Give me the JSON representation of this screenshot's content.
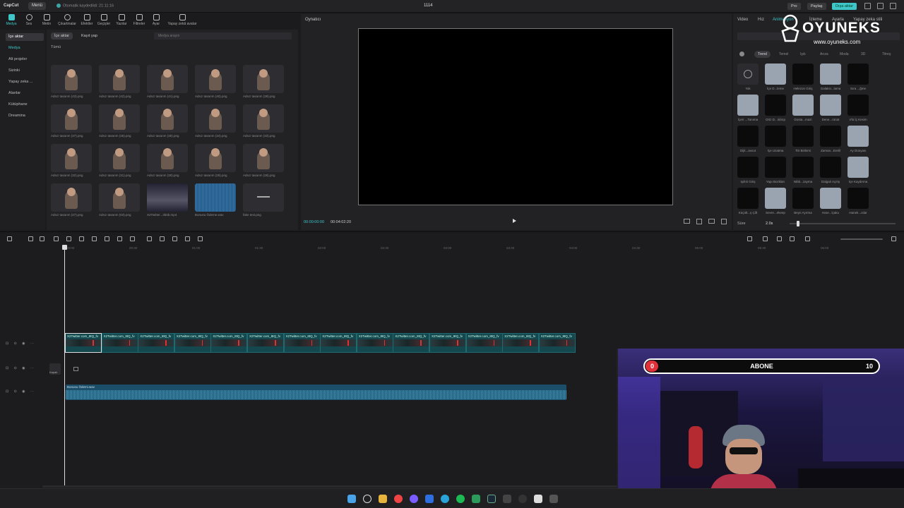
{
  "titlebar": {
    "app_name": "CapCut",
    "menu_label": "Menü",
    "autosave_text": "Otomatik kaydedildi: 21:11:16",
    "project_title": "1114",
    "pro_label": "Pro",
    "share_label": "Paylaş",
    "export_label": "Dışa aktar"
  },
  "top_tools": [
    {
      "label": "Medya",
      "icon": "media-icon"
    },
    {
      "label": "Ses",
      "icon": "audio-icon"
    },
    {
      "label": "Metin",
      "icon": "text-icon"
    },
    {
      "label": "Çıkartmalar",
      "icon": "sticker-icon"
    },
    {
      "label": "Efektler",
      "icon": "effects-icon"
    },
    {
      "label": "Geçişler",
      "icon": "transition-icon"
    },
    {
      "label": "Yazılar",
      "icon": "captions-icon"
    },
    {
      "label": "Filtreler",
      "icon": "filter-icon"
    },
    {
      "label": "Ayar",
      "icon": "adjust-icon"
    },
    {
      "label": "Yapay zekâ avatar",
      "icon": "avatar-icon"
    }
  ],
  "left_nav": [
    {
      "label": "İçe aktar"
    },
    {
      "label": "Medya"
    },
    {
      "label": "Alt projeler"
    },
    {
      "label": "Sizinki"
    },
    {
      "label": "Yapay zeka ..."
    },
    {
      "label": "Alanlar"
    },
    {
      "label": "Kütüphane"
    },
    {
      "label": "Dreamina"
    }
  ],
  "media_panel": {
    "import_tab": "İçe aktar",
    "record_tab": "Kayıt yap",
    "search_placeholder": "Medya arayın",
    "section_label": "Tümü",
    "thumbnails": [
      {
        "label": "Adsız tasarım (43).png"
      },
      {
        "label": "Adsız tasarım (42).png"
      },
      {
        "label": "Adsız tasarım (41).png"
      },
      {
        "label": "Adsız tasarım (40).png"
      },
      {
        "label": "Adsız tasarım (39).png"
      },
      {
        "label": "Adsız tasarım (37).png"
      },
      {
        "label": "Adsız tasarım (36).png"
      },
      {
        "label": "Adsız tasarım (35).png"
      },
      {
        "label": "Adsız tasarım (34).png"
      },
      {
        "label": "Adsız tasarım (33).png"
      },
      {
        "label": "Adsız tasarım (32).png"
      },
      {
        "label": "Adsız tasarım (31).png"
      },
      {
        "label": "Adsız tasarım (30).png"
      },
      {
        "label": "Adsız tasarım (29).png"
      },
      {
        "label": "Adsız tasarım (28).png"
      },
      {
        "label": "Adsız tasarım (27).png"
      },
      {
        "label": "Adsız tasarım (03).png"
      },
      {
        "label": "X2Twitter...3b0b.mp4"
      },
      {
        "label": "Bonusu Ödeme.wav"
      },
      {
        "label": "fake text.png"
      }
    ]
  },
  "player": {
    "title": "Oynatıcı",
    "current_time": "00:00:00:00",
    "total_time": "00:04:02:20"
  },
  "properties": {
    "tabs": [
      "Video",
      "Hız",
      "Animasyon",
      "İzleme",
      "Ayarla",
      "Yapay zeka stili"
    ],
    "categories": [
      "Trend",
      "Temel",
      "Işık",
      "Arıza",
      "Moda",
      "3D",
      "Titreş"
    ],
    "animations": [
      "Yok",
      "İçe D...leme",
      "Helezon Giriş",
      "Galaksi...lama",
      "Sıra ...ğme",
      "İçeri ...Tanıma",
      "Ortz D...ıldırıp",
      "Dosta...mazi",
      "Dene...rünüt",
      "4'lü İç Kesim",
      "Dijit...avcut",
      "İçe Uzatma",
      "Titr Birikimi",
      "Zaman...Erelil",
      "Ay Dünyası",
      "Işıltılı Giriş",
      "Yapı Bozkları",
      "Nibb...zayma",
      "Dalgalı Açılış",
      "İçe Kaydırma",
      "Küçült...ş Çift",
      "Sevre...ekeep",
      "Beyn Ayırma",
      "Hare...lçaku",
      "Hanek...ıslar"
    ],
    "duration_label": "Süre",
    "duration_value": "2.0s"
  },
  "timeline": {
    "ruler": [
      "00:00",
      "00:30",
      "01:00",
      "01:30",
      "02:00",
      "02:30",
      "03:00",
      "03:30",
      "04:00",
      "04:30",
      "05:00",
      "05:30",
      "06:00"
    ],
    "video_clip_label": "X2Twitter.com_8tQ_fv",
    "cover_label": "Kapak",
    "audio_clip_label": "Bonusu Ödemi.wav"
  },
  "webcam": {
    "sub_left": "0",
    "sub_center": "ABONE",
    "sub_right": "10",
    "sub_progress": 0.04,
    "accent": "#e0303a"
  },
  "brand": {
    "name": "OYUNEKS",
    "url": "www.oyuneks.com"
  },
  "colors": {
    "accent": "#3ec6c9",
    "background": "#1b1b1d"
  }
}
